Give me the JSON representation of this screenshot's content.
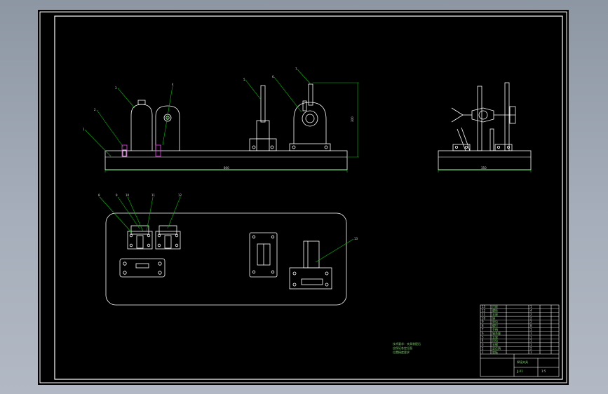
{
  "sheet": {
    "background_color": "#000000",
    "line_color": "#ffffff",
    "leader_color": "#00c400",
    "dimension_color": "#00c400"
  },
  "part_balloons": {
    "front_view": [
      "1",
      "2",
      "3",
      "4",
      "5",
      "6",
      "7"
    ],
    "plan_view": [
      "8",
      "9",
      "10",
      "11",
      "12",
      "13"
    ]
  },
  "dimensions": {
    "front_length": "800",
    "front_height": "300",
    "side_length": "350"
  },
  "notes": {
    "technical_requirements": [
      "技术要求：夹具装配后",
      "应保证各定位面",
      "位置精度要求"
    ]
  },
  "title_block": {
    "title": "焊接夹具",
    "drawing_no": "JJ-01",
    "scale": "1:5",
    "rows": [
      [
        "13",
        "压板",
        "1"
      ],
      [
        "12",
        "螺栓",
        "4"
      ],
      [
        "11",
        "支座",
        "2"
      ],
      [
        "10",
        "销",
        "2"
      ],
      [
        "9",
        "垫块",
        "2"
      ],
      [
        "8",
        "螺钉",
        "8"
      ],
      [
        "7",
        "手柄",
        "1"
      ],
      [
        "6",
        "轴承座",
        "1"
      ],
      [
        "5",
        "支架",
        "1"
      ],
      [
        "4",
        "压块",
        "1"
      ],
      [
        "3",
        "支撑",
        "1"
      ],
      [
        "2",
        "定位销",
        "2"
      ],
      [
        "1",
        "底板",
        "1"
      ]
    ]
  }
}
